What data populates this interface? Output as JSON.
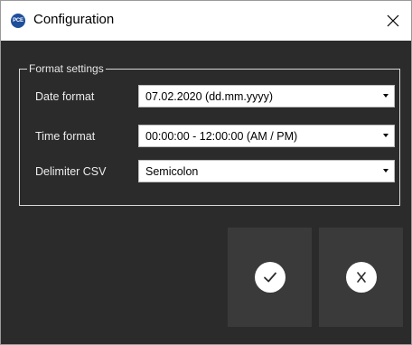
{
  "window": {
    "title": "Configuration",
    "icon_text": "PCE"
  },
  "format_settings": {
    "legend": "Format settings",
    "rows": [
      {
        "label": "Date format",
        "value": "07.02.2020 (dd.mm.yyyy)"
      },
      {
        "label": "Time format",
        "value": "00:00:00 - 12:00:00 (AM / PM)"
      },
      {
        "label": "Delimiter CSV",
        "value": "Semicolon"
      }
    ]
  },
  "buttons": {
    "confirm_icon": "checkmark-icon",
    "cancel_icon": "x-icon"
  },
  "colors": {
    "background": "#2b2b2b",
    "button_bg": "#3a3a3a",
    "titlebar": "#ffffff",
    "icon_blue": "#1f4f9c"
  }
}
